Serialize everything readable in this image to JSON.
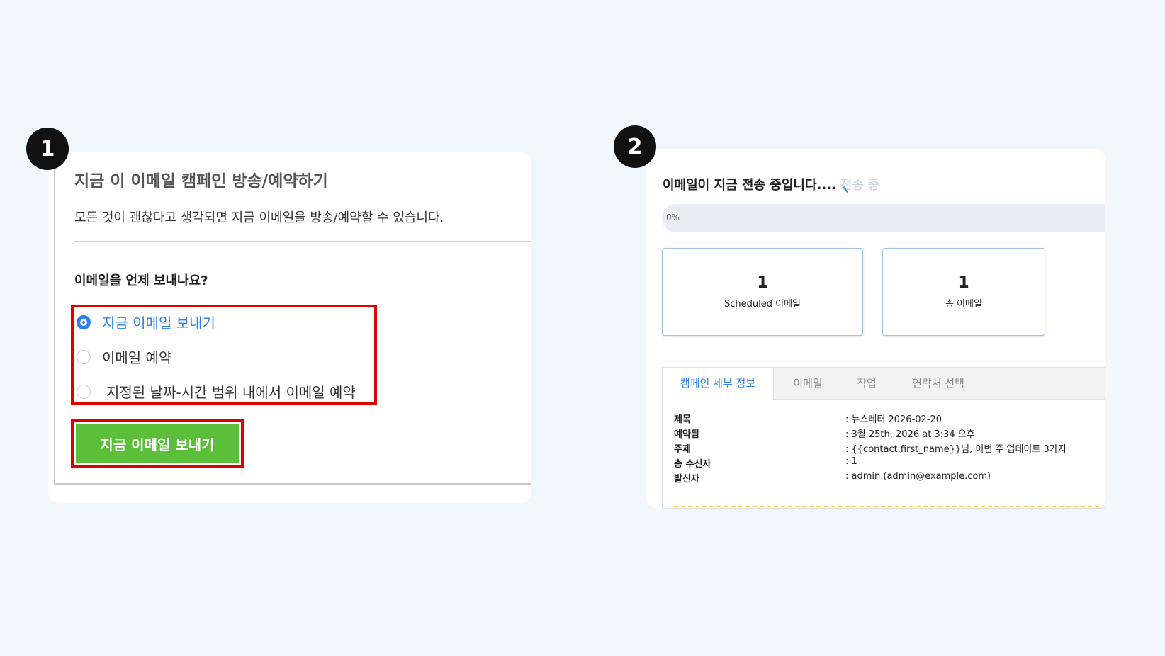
{
  "steps": [
    "1",
    "2"
  ],
  "panel1": {
    "title": "지금 이 이메일 캠페인 방송/예약하기",
    "description": "모든 것이 괜찮다고 생각되면 지금 이메일을 방송/예약할 수 있습니다.",
    "question": "이메일을 언제 보내나요?",
    "options": [
      {
        "label": "지금 이메일 보내기",
        "checked": true
      },
      {
        "label": "이메일 예약",
        "checked": false
      },
      {
        "label": "지정된 날짜-시간 범위 내에서 이메일 예약",
        "checked": false
      }
    ],
    "send_button": "지금 이메일 보내기",
    "highlight_color": "#e00000",
    "button_color": "#5cbf3a",
    "accent_color": "#2f80ed"
  },
  "panel2": {
    "title": "이메일이 지금 전송 중입니다....",
    "status": "전송 중",
    "progress": {
      "label": "0%",
      "value": 0
    },
    "stats": [
      {
        "number": "1",
        "label": "Scheduled 이메일"
      },
      {
        "number": "1",
        "label": "총 이메일"
      }
    ],
    "tabs": [
      "캠페인 세부 정보",
      "이메일",
      "작업",
      "연락처 선택"
    ],
    "details": [
      {
        "key": "제목",
        "value": ": 뉴스레터 2026-02-20"
      },
      {
        "key": "예약됨",
        "value": ": 3월 25th, 2026 at 3:34 오후"
      },
      {
        "key": "주제",
        "value": ": {{contact.first_name}}님, 이번 주 업데이트 3가지"
      },
      {
        "key": "총 수신자",
        "value": ": 1"
      },
      {
        "key": "발신자",
        "value": ": admin (admin@example.com)"
      }
    ]
  }
}
